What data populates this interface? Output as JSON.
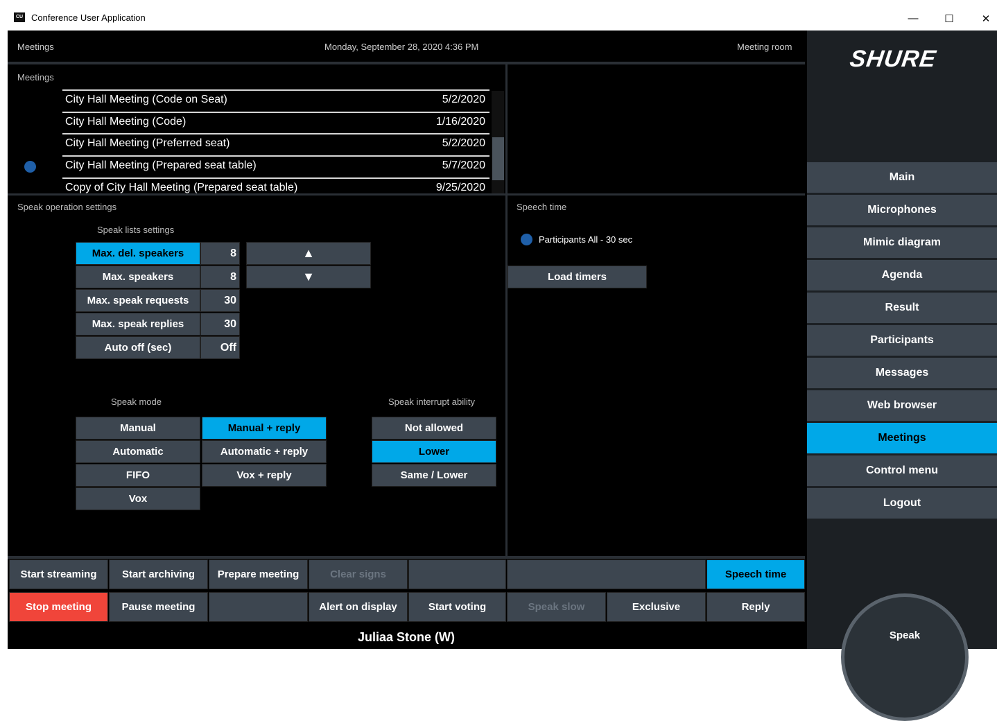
{
  "window": {
    "title": "Conference User Application",
    "icon_text": "CU",
    "minimize": "—",
    "maximize": "☐",
    "close": "✕"
  },
  "header": {
    "left": "Meetings",
    "datetime": "Monday, September 28, 2020 4:36 PM",
    "right": "Meeting room"
  },
  "meetings": {
    "section_title": "Meetings",
    "rows": [
      {
        "name": "City Hall Meeting (Code on Seat)",
        "date": "5/2/2020"
      },
      {
        "name": "City Hall Meeting (Code)",
        "date": "1/16/2020"
      },
      {
        "name": "City Hall Meeting (Preferred seat)",
        "date": "5/2/2020"
      },
      {
        "name": "City Hall Meeting (Prepared seat table)",
        "date": "5/7/2020"
      },
      {
        "name": "Copy of City Hall Meeting (Prepared seat table)",
        "date": "9/25/2020"
      }
    ]
  },
  "speak_operation": {
    "section_title": "Speak operation settings",
    "lists_title": "Speak lists settings",
    "settings": [
      {
        "label": "Max. del. speakers",
        "value": "8"
      },
      {
        "label": "Max. speakers",
        "value": "8"
      },
      {
        "label": "Max. speak requests",
        "value": "30"
      },
      {
        "label": "Max. speak replies",
        "value": "30"
      },
      {
        "label": "Auto off (sec)",
        "value": "Off"
      }
    ],
    "up_arrow": "▲",
    "down_arrow": "▼",
    "mode_title": "Speak mode",
    "modes": [
      "Manual",
      "Manual + reply",
      "Automatic",
      "Automatic + reply",
      "FIFO",
      "Vox + reply",
      "Vox"
    ],
    "interrupt_title": "Speak interrupt ability",
    "interrupt": [
      "Not allowed",
      "Lower",
      "Same / Lower"
    ]
  },
  "speech_time": {
    "section_title": "Speech time",
    "timer": "Participants All - 30 sec",
    "load_button": "Load timers"
  },
  "bottom_row1": [
    "Start streaming",
    "Start archiving",
    "Prepare meeting",
    "Clear signs",
    "",
    "",
    "Speech time"
  ],
  "bottom_row2": [
    "Stop meeting",
    "Pause meeting",
    "",
    "Alert on display",
    "Start voting",
    "Speak slow",
    "Exclusive",
    "Reply"
  ],
  "status_user": "Juliaa Stone (W)",
  "sidebar": {
    "brand": "SHURE",
    "nav": [
      "Main",
      "Microphones",
      "Mimic diagram",
      "Agenda",
      "Result",
      "Participants",
      "Messages",
      "Web browser",
      "Meetings",
      "Control menu",
      "Logout"
    ],
    "speak_label": "Speak"
  },
  "colors": {
    "accent": "#00a8e8",
    "button": "#3d4650",
    "stop": "#f0453a",
    "indicator": "#1f5fa8"
  }
}
